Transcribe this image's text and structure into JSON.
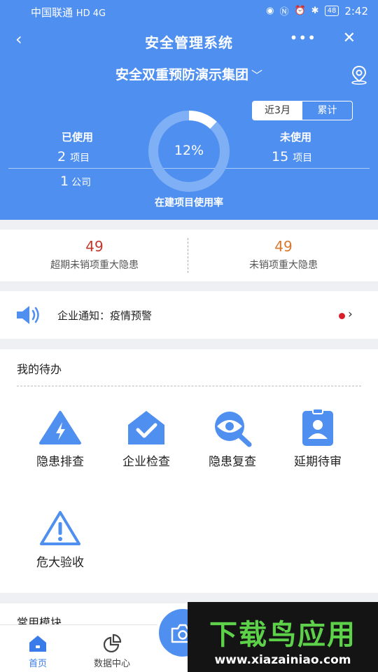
{
  "status_bar": {
    "carrier": "中国联通",
    "network": "HD 4G",
    "battery": "48",
    "time": "2:42"
  },
  "nav": {
    "title": "安全管理系统",
    "more_glyph": "•••",
    "back_glyph": "‹",
    "close_glyph": "✕"
  },
  "company": {
    "name": "安全双重预防演示集团",
    "chevron": "﹀"
  },
  "period_toggle": {
    "options": [
      "近3月",
      "累计"
    ],
    "selected": "近3月"
  },
  "usage": {
    "used_label": "已使用",
    "used_projects": "2",
    "project_unit": "项目",
    "used_companies": "1",
    "company_unit": "公司",
    "unused_label": "未使用",
    "unused_projects": "15",
    "rate": "12%",
    "rate_fraction": 0.12,
    "rate_label": "在建项目使用率"
  },
  "hazards": {
    "overdue_count": "49",
    "overdue_label": "超期未销项重大隐患",
    "open_count": "49",
    "open_label": "未销项重大隐患"
  },
  "notice": {
    "text": "企业通知：疫情预警",
    "arrow": "›"
  },
  "todo": {
    "title": "我的待办",
    "items": [
      {
        "label": "隐患排查",
        "icon": "lightning-warning-icon"
      },
      {
        "label": "企业检查",
        "icon": "house-check-icon"
      },
      {
        "label": "隐患复查",
        "icon": "eye-magnifier-icon"
      },
      {
        "label": "延期待审",
        "icon": "id-badge-icon"
      },
      {
        "label": "危大验收",
        "icon": "exclamation-triangle-icon"
      }
    ]
  },
  "common_modules": {
    "title": "常用模块"
  },
  "tabbar": {
    "home": "首页",
    "data_center": "数据中心"
  },
  "watermark": {
    "main": "下载鸟应用",
    "url": "www.xiazainiao.com"
  },
  "colors": {
    "primary": "#4f8ff0",
    "overdue": "#c0392b",
    "open": "#d9782b",
    "notice_dot": "#d81e2a",
    "watermark_green": "#5dd14a"
  }
}
